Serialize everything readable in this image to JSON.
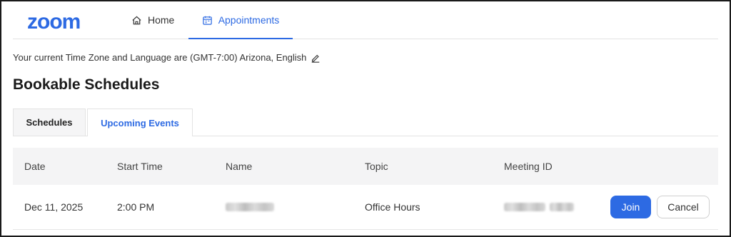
{
  "nav": {
    "logo": "zoom",
    "home_label": "Home",
    "appointments_label": "Appointments"
  },
  "timezone_line": "Your current Time Zone and Language are (GMT-7:00) Arizona, English",
  "page_title": "Bookable Schedules",
  "tabs": [
    {
      "label": "Schedules"
    },
    {
      "label": "Upcoming Events",
      "active": true
    }
  ],
  "table": {
    "headers": [
      "Date",
      "Start Time",
      "Name",
      "Topic",
      "Meeting ID"
    ],
    "rows": [
      {
        "date": "Dec 11, 2025",
        "start_time": "2:00 PM",
        "topic": "Office Hours",
        "join_label": "Join",
        "cancel_label": "Cancel"
      }
    ]
  },
  "colors": {
    "accent": "#2d6ae3",
    "header_bg": "#f4f4f5"
  },
  "icons": {
    "home": "home-icon",
    "appointments": "calendar-icon",
    "edit": "pencil-icon"
  }
}
